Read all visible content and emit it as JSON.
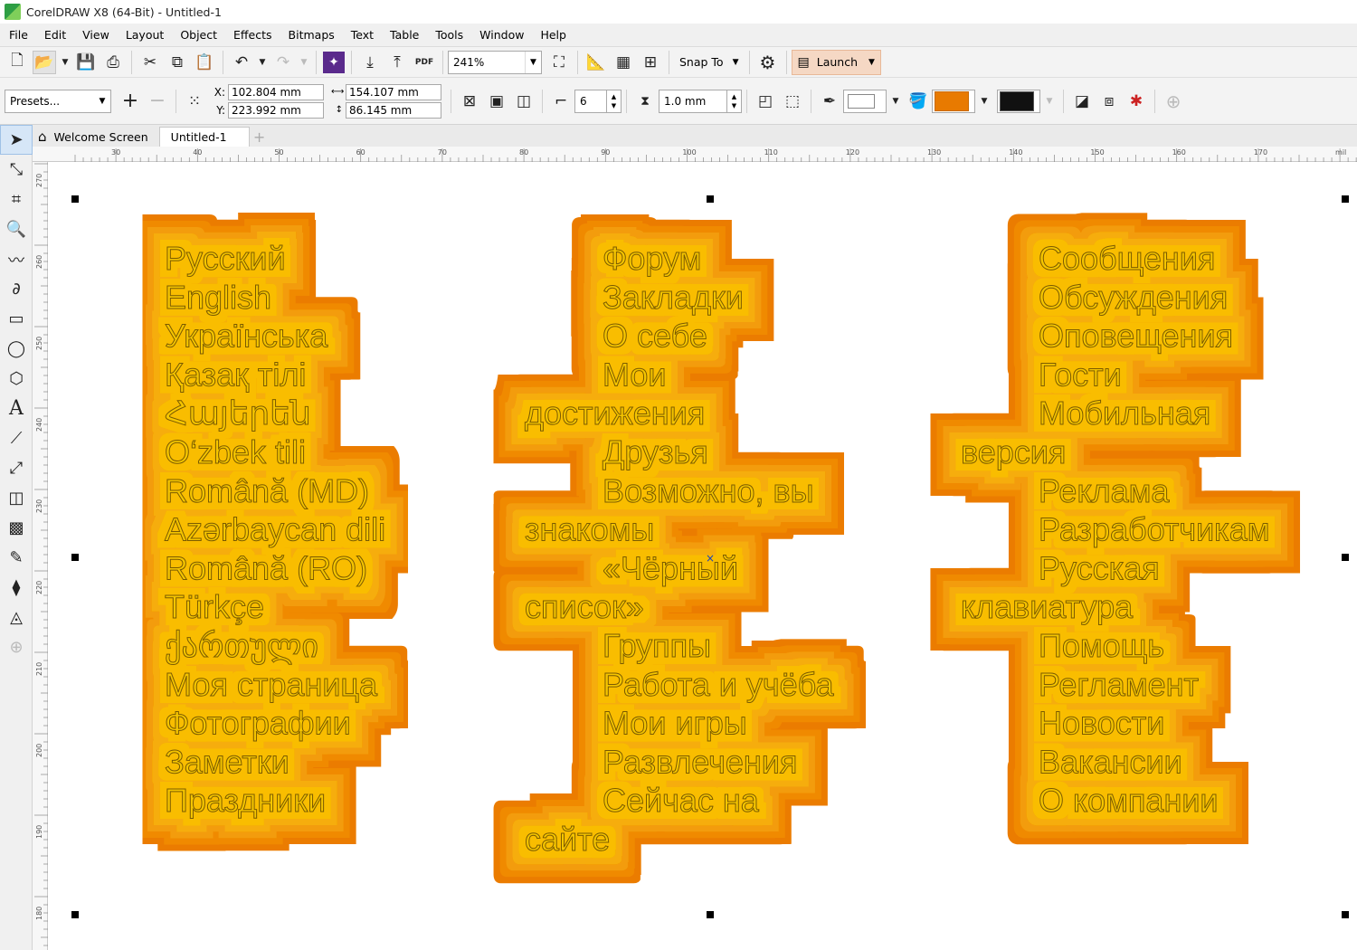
{
  "app": {
    "title": "CorelDRAW X8 (64-Bit) - Untitled-1"
  },
  "menu": [
    "File",
    "Edit",
    "View",
    "Layout",
    "Object",
    "Effects",
    "Bitmaps",
    "Text",
    "Table",
    "Tools",
    "Window",
    "Help"
  ],
  "toolbar": {
    "zoom": "241%",
    "snap_label": "Snap To",
    "launch_label": "Launch",
    "pdf_label": "PDF"
  },
  "property_bar": {
    "presets": "Presets...",
    "x_label": "X:",
    "y_label": "Y:",
    "x": "102.804 mm",
    "y": "223.992 mm",
    "width": "154.107 mm",
    "height": "86.145 mm",
    "steps": "6",
    "offset": "1.0 mm",
    "fill_color": "#e87a00",
    "outline_color": "#ffffff",
    "accel_color": "#111111"
  },
  "tabs": [
    "Welcome Screen",
    "Untitled-1"
  ],
  "ruler": {
    "h_ticks": [
      "30",
      "40",
      "50",
      "60",
      "70",
      "80",
      "90",
      "100",
      "110",
      "120",
      "130",
      "140",
      "150",
      "160",
      "170",
      "mil"
    ],
    "v_ticks": [
      "270",
      "260",
      "250",
      "240",
      "230",
      "220",
      "210",
      "200",
      "190",
      "180"
    ]
  },
  "columns": [
    {
      "name": "languages",
      "lines": [
        "Русский",
        "English",
        "Українська",
        "Қазақ тілі",
        "Հայերեն",
        "O‘zbek tili",
        "Română (MD)",
        "Azərbaycan dili",
        "Română (RO)",
        "Türkçe",
        "ქართული",
        "Моя страница",
        "Фотографии",
        "Заметки",
        "Праздники"
      ]
    },
    {
      "name": "menu-a",
      "lines": [
        "Форум",
        "Закладки",
        "О себе",
        "Мои",
        "достижения",
        "Друзья",
        "Возможно, вы",
        "знакомы",
        "«Чёрный",
        "список»",
        "Группы",
        "Работа и учёба",
        "Мои игры",
        "Развлечения",
        "Сейчас на",
        "сайте"
      ]
    },
    {
      "name": "menu-b",
      "lines": [
        "Сообщения",
        "Обсуждения",
        "Оповещения",
        "Гости",
        "Мобильная",
        "версия",
        "Реклама",
        "Разработчикам",
        "Русская",
        "клавиатура",
        "Помощь",
        "Регламент",
        "Новости",
        "Вакансии",
        "О компании"
      ]
    }
  ],
  "colors": {
    "orange_outer": "#eb7c06",
    "orange_mid": "#f39c0a",
    "yellow_inner": "#fac800",
    "text_fill": "#f6c600",
    "text_stroke": "#7a5a00"
  }
}
